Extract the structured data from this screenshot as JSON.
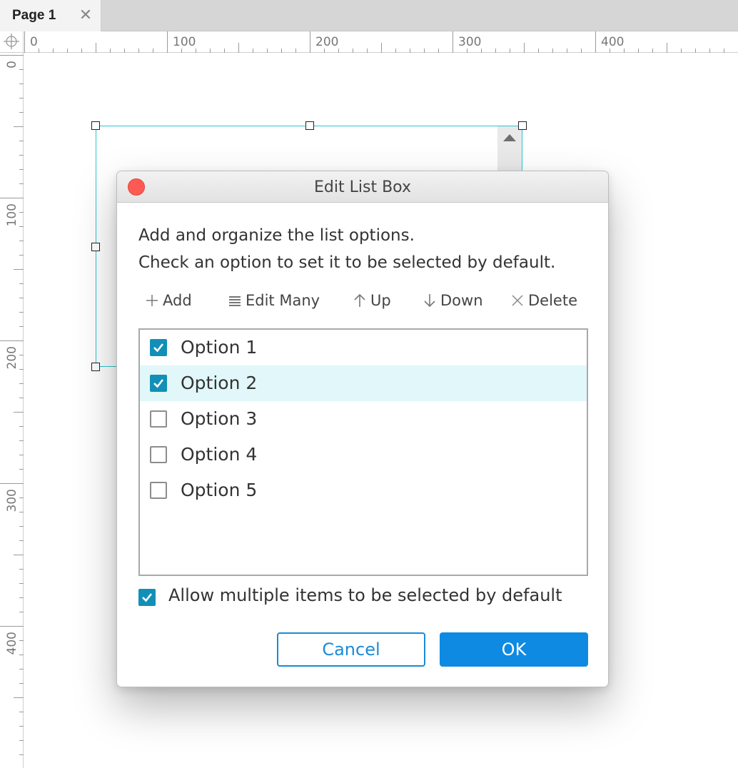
{
  "tab": {
    "label": "Page 1",
    "close_glyph": "✕"
  },
  "rulers": {
    "horizontal_labels": [
      "0",
      "100",
      "200",
      "300",
      "400"
    ],
    "vertical_labels": [
      "0",
      "100",
      "200",
      "300",
      "400"
    ]
  },
  "dialog": {
    "title": "Edit List Box",
    "instructions": [
      "Add and organize the list options.",
      "Check an option to set it to be selected by default."
    ],
    "toolbar": {
      "add": "Add",
      "edit_many": "Edit Many",
      "up": "Up",
      "down": "Down",
      "delete": "Delete"
    },
    "options": [
      {
        "label": "Option 1",
        "checked": true
      },
      {
        "label": "Option 2",
        "checked": true
      },
      {
        "label": "Option 3",
        "checked": false
      },
      {
        "label": "Option 4",
        "checked": false
      },
      {
        "label": "Option 5",
        "checked": false
      }
    ],
    "allow_multiple": {
      "label": "Allow multiple items to be selected by default",
      "checked": true
    },
    "cancel_label": "Cancel",
    "ok_label": "OK"
  },
  "icons": {
    "add": "plus-icon",
    "edit_many": "list-lines-icon",
    "up": "arrow-up-icon",
    "down": "arrow-down-icon",
    "delete": "x-icon"
  },
  "colors": {
    "accent": "#0e8ae3",
    "checkbox": "#128fb7",
    "selection_outline": "#2ac7cf",
    "row_highlight": "#e1f7f9",
    "close_dot": "#fd5a54"
  }
}
